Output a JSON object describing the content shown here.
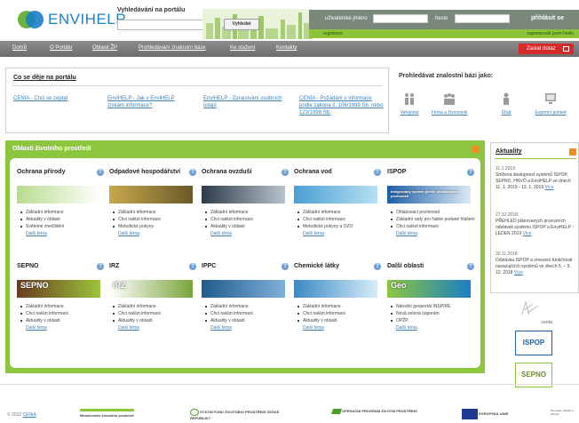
{
  "header": {
    "logo_text": "ENVIHELP",
    "search_label": "Vyhledávání na portálu",
    "search_button": "Vyhledat",
    "login": {
      "username_label": "uživatelské jméno",
      "password_label": "heslo",
      "login_button": "přihlásit se",
      "register_link": "registrace",
      "forgot_link": "zapomenuté jsem heslo"
    }
  },
  "nav": {
    "items": [
      "Domů",
      "O Portálu",
      "Oblasti ŽP",
      "Prohledávání znalostní báze",
      "Ke stažení",
      "Kontakty"
    ],
    "report_button": "Zaslat dotaz"
  },
  "news": {
    "title": "Co se děje na portálu",
    "links": [
      "CENIA - Chci se zeptat",
      "EnviHELP - Jak v EnviHELP získám informace?",
      "EnviHELP - Zpracování osobních údajů",
      "CENIA - Požádání o informace podle zákona č. 106/1999 Sb. nebo 123/1998 Sb."
    ]
  },
  "knowledge_base": {
    "title": "Prohledávat znalostní bázi jako:",
    "items": [
      "Veřejnost",
      "Firma a živnostník",
      "Úřad",
      "Expertní pohled"
    ]
  },
  "areas": {
    "title": "Oblasti životního prostředí",
    "more_label": "Další téma",
    "help_glyph": "?",
    "items": [
      {
        "title": "Ochrana přírody",
        "links": [
          "Základní informace",
          "Aktuality v oblasti",
          "Světelné znečištění"
        ],
        "colors": [
          "#b7dc8e",
          "#ffffff"
        ]
      },
      {
        "title": "Odpadové hospodářství",
        "links": [
          "Základní informace",
          "Chci nalézt informace",
          "Metodické pokyny"
        ],
        "colors": [
          "#c8a84b",
          "#6a5a2a"
        ]
      },
      {
        "title": "Ochrana ovzduší",
        "links": [
          "Základní informace",
          "Chci nalézt informace",
          "Aktuality v oblasti"
        ],
        "colors": [
          "#2d3b4a",
          "#b8c3cc"
        ]
      },
      {
        "title": "Ochrana vod",
        "links": [
          "Základní informace",
          "Chci nalézt informace",
          "Metodické pokyny a OZO"
        ],
        "colors": [
          "#4a9fd3",
          "#b7dff3"
        ]
      },
      {
        "title": "ISPOP",
        "links": [
          "Ohlašovací povinnosti",
          "Základní rady pro řádné podané hlášení",
          "Chci nalézt informace"
        ],
        "colors": [
          "#1b5fa8",
          "#dce8f5"
        ],
        "banner_text": "Integrovaný systém plnění ohlašovacích povinností"
      },
      {
        "title": "SEPNO",
        "links": [
          "Základní informace",
          "Chci nalézt informace",
          "Aktuality v oblasti"
        ],
        "colors": [
          "#6b3b1f",
          "#9bc43a"
        ],
        "banner_text": "SEPNO"
      },
      {
        "title": "IRZ",
        "links": [
          "Základní informace",
          "Chci nalézt informace",
          "Aktuality v oblasti"
        ],
        "colors": [
          "#ffffff",
          "#7aa43b"
        ],
        "banner_text": "IRZ"
      },
      {
        "title": "IPPC",
        "links": [
          "Základní informace",
          "Chci nalézt informace",
          "Aktuality v oblasti"
        ],
        "colors": [
          "#1f5c8c",
          "#7fb0d9"
        ]
      },
      {
        "title": "Chemické látky",
        "links": [
          "Základní informace",
          "Chci nalézt informace",
          "Aktuality v oblasti"
        ],
        "colors": [
          "#3a8ac5",
          "#d6ecf8"
        ]
      },
      {
        "title": "Další oblasti",
        "links": [
          "Národní geoportál INSPIRE",
          "Nová zelená úsporám",
          "OPŽP"
        ],
        "colors": [
          "#8cc63f",
          "#1b7fc4"
        ],
        "banner_text": "Geo"
      }
    ]
  },
  "aktuality": {
    "title": "Aktuality",
    "more_label": "Více",
    "items": [
      {
        "date": "11.1.2019",
        "text": "Snížená dostupnost systémů ISPOP, SEPNO, HNVO a EnviHELP ve dnech 11. 1. 2019 - 13. 1. 2019"
      },
      {
        "date": "27.12.2018",
        "text": "PŘEHLED plánovaných provozních odstávek systému ISPOP a EnviHELP - LEDEN 2019"
      },
      {
        "date": "30.11.2018",
        "text": "Odstávka ISPOP a omezení funkčnosti navazujících systémů ve dnech 5. – 9. 12. 2018"
      }
    ]
  },
  "side_logos": [
    "cenia",
    "ISPOP",
    "SEPNO"
  ],
  "footer": {
    "copyright": "© 2012",
    "copyright_link": "CENIA",
    "logos": [
      "Ministerstvo životního prostředí",
      "STÁTNÍ FOND ŽIVOTNÍHO PROSTŘEDÍ ČESKÉ REPUBLIKY",
      "OPERAČNÍ PROGRAM ŽIVOTNÍ PROSTŘEDÍ",
      "EVROPSKÁ UNIE",
      "Pro vodu, vzduch a přírodu"
    ]
  },
  "colors": {
    "accent_green": "#8cc63f",
    "brand_blue": "#1b7fc4",
    "link_blue": "#3a7fb8",
    "report_red": "#d62b2b",
    "nav_grey": "#7a7a7a"
  }
}
